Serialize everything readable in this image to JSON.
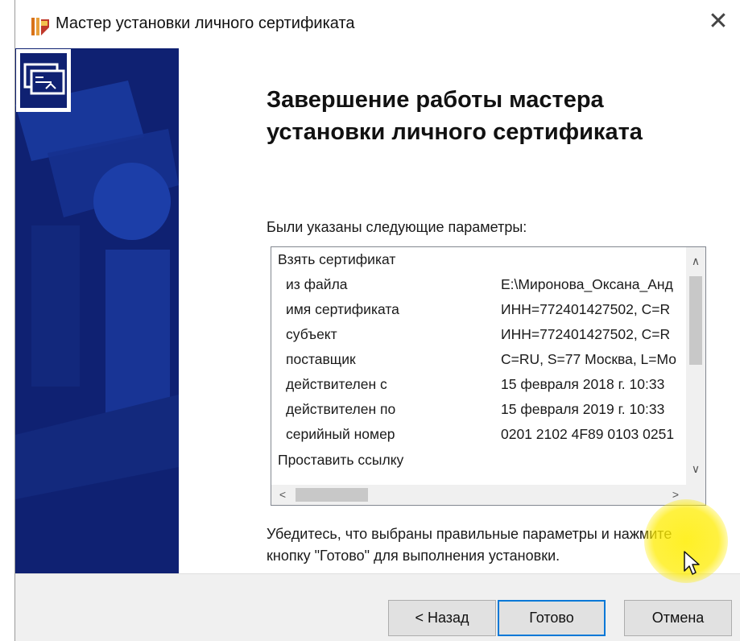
{
  "window": {
    "title": "Мастер установки личного сертификата",
    "close_glyph": "✕",
    "icon": "cryptopro-app-icon"
  },
  "banner": {
    "icon": "certificate-icon",
    "background_color": "#0f2172"
  },
  "main": {
    "heading": "Завершение работы мастера установки личного сертификата",
    "params_label": "Были указаны следующие параметры:",
    "instruction": "Убедитесь, что выбраны правильные параметры и нажмите кнопку \"Готово\" для выполнения установки."
  },
  "params": [
    {
      "key": "Взять сертификат",
      "value": "",
      "top_level": true
    },
    {
      "key": "из файла",
      "value": "E:\\Миронова_Оксана_Анд",
      "top_level": false
    },
    {
      "key": "имя сертификата",
      "value": "ИНН=772401427502, C=R",
      "top_level": false
    },
    {
      "key": "субъект",
      "value": "ИНН=772401427502, C=R",
      "top_level": false
    },
    {
      "key": "поставщик",
      "value": "C=RU, S=77 Москва, L=Мо",
      "top_level": false
    },
    {
      "key": "действителен с",
      "value": "15 февраля 2018 г. 10:33",
      "top_level": false
    },
    {
      "key": "действителен по",
      "value": "15 февраля 2019 г. 10:33",
      "top_level": false
    },
    {
      "key": "серийный номер",
      "value": "0201 2102 4F89 0103 0251",
      "top_level": false
    },
    {
      "key": "Проставить ссылку",
      "value": "",
      "top_level": true
    }
  ],
  "scroll": {
    "up": "∧",
    "down": "∨",
    "left": "<",
    "right": ">"
  },
  "buttons": {
    "back": "< Назад",
    "finish": "Готово",
    "cancel": "Отмена"
  },
  "colors": {
    "accent": "#0078d7",
    "highlight": "#ffee00"
  }
}
